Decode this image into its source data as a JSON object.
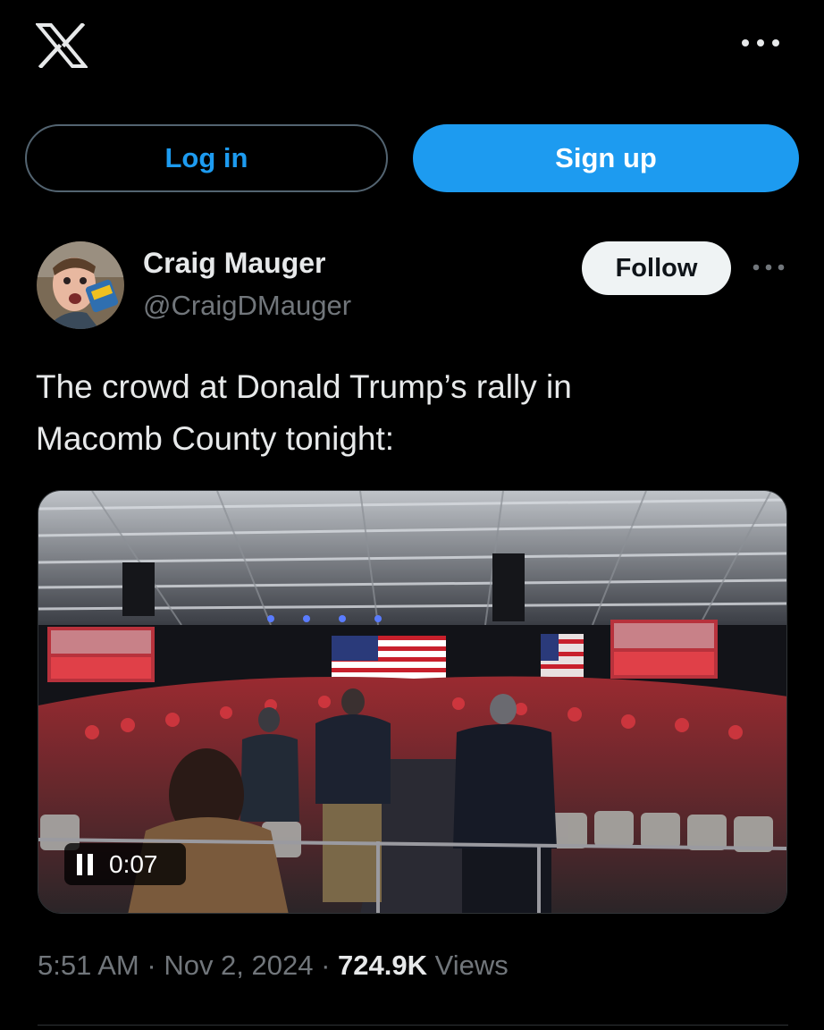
{
  "header": {
    "logo_icon": "x-logo-icon",
    "more_icon": "more-horizontal-icon"
  },
  "auth": {
    "login_label": "Log in",
    "signup_label": "Sign up"
  },
  "author": {
    "name": "Craig Mauger",
    "handle": "@CraigDMauger",
    "follow_label": "Follow",
    "more_icon": "more-horizontal-icon"
  },
  "tweet": {
    "line1": "The crowd at Donald Trump’s rally in",
    "line2": "Macomb County tonight:"
  },
  "media": {
    "type": "video",
    "control_icon": "pause-icon",
    "time": "0:07"
  },
  "meta": {
    "time": "5:51 AM",
    "sep1": " · ",
    "date": "Nov 2, 2024",
    "sep2": " · ",
    "views_count": "724.9K",
    "views_label": " Views"
  },
  "colors": {
    "background": "#000000",
    "accent": "#1d9bf0",
    "text_primary": "#e7e9ea",
    "text_secondary": "#71767b"
  }
}
